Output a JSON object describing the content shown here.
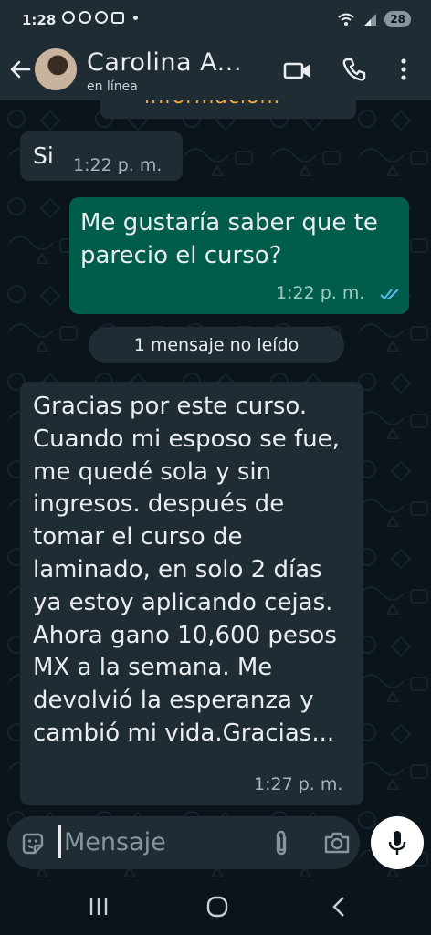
{
  "status_bar": {
    "time": "1:28",
    "battery": "28"
  },
  "header": {
    "contact_name": "Carolina A...",
    "status": "en línea"
  },
  "messages": {
    "top_partial_text": "información.",
    "m1": {
      "text": "Si",
      "time": "1:22 p. m."
    },
    "m2": {
      "text": "Me gustaría saber que te parecio el curso?",
      "time": "1:22 p. m.",
      "read_status": "double-check-read"
    },
    "unread_banner": "1 mensaje no leído",
    "m3": {
      "text": "Gracias por este curso. Cuando mi esposo se fue, me quedé sola y sin ingresos. después de tomar el curso de laminado, en solo 2 días ya estoy aplicando cejas. Ahora gano 10,600 pesos MX a la semana. Me devolvió la esperanza y cambió mi vida.Gracias...",
      "time": "1:27 p. m."
    }
  },
  "input": {
    "placeholder": "Mensaje"
  },
  "icons": {
    "back": "arrow-left-icon",
    "video": "video-call-icon",
    "phone": "voice-call-icon",
    "menu": "more-vert-icon",
    "emoji": "sticker-emoji-icon",
    "attach": "paperclip-icon",
    "camera": "camera-icon",
    "mic": "microphone-icon"
  },
  "colors": {
    "incoming_bubble": "#202c33",
    "outgoing_bubble": "#005c4b",
    "header": "#1f2c34",
    "read_ticks": "#53bdeb"
  }
}
